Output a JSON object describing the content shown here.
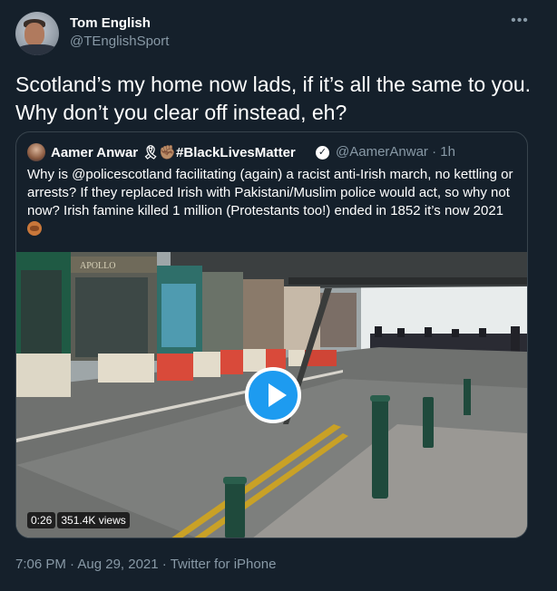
{
  "author": {
    "name": "Tom English",
    "handle": "@TEnglishSport"
  },
  "tweet": {
    "text": "Scotland’s my home now lads, if it’s all the same to you. Why don’t you clear off instead, eh?"
  },
  "quoted": {
    "name": "Aamer Anwar 🎗✊🏽#BlackLivesMatter",
    "verified_mark": "✓",
    "handle_time": "@AamerAnwar · 1h",
    "text": "Why is @policescotland facilitating (again) a racist anti-Irish march, no kettling or arrests? If they replaced Irish with Pakistani/Muslim police would act, so why not now? Irish famine killed 1 million (Protestants too!) ended in 1852 it’s now 2021"
  },
  "video": {
    "duration": "0:26",
    "views": "351.4K views",
    "shop_sign": "APOLLO"
  },
  "footer": {
    "timestamp": "7:06 PM · Aug 29, 2021",
    "separator": " · ",
    "client": "Twitter for iPhone"
  },
  "more_glyph": "•••",
  "colors": {
    "background": "#15202b",
    "text_secondary": "#8899a6",
    "border": "#38444d",
    "accent": "#1d9bf0"
  },
  "icons": [
    "more-icon",
    "verified-icon",
    "play-icon",
    "emoji-icon"
  ]
}
